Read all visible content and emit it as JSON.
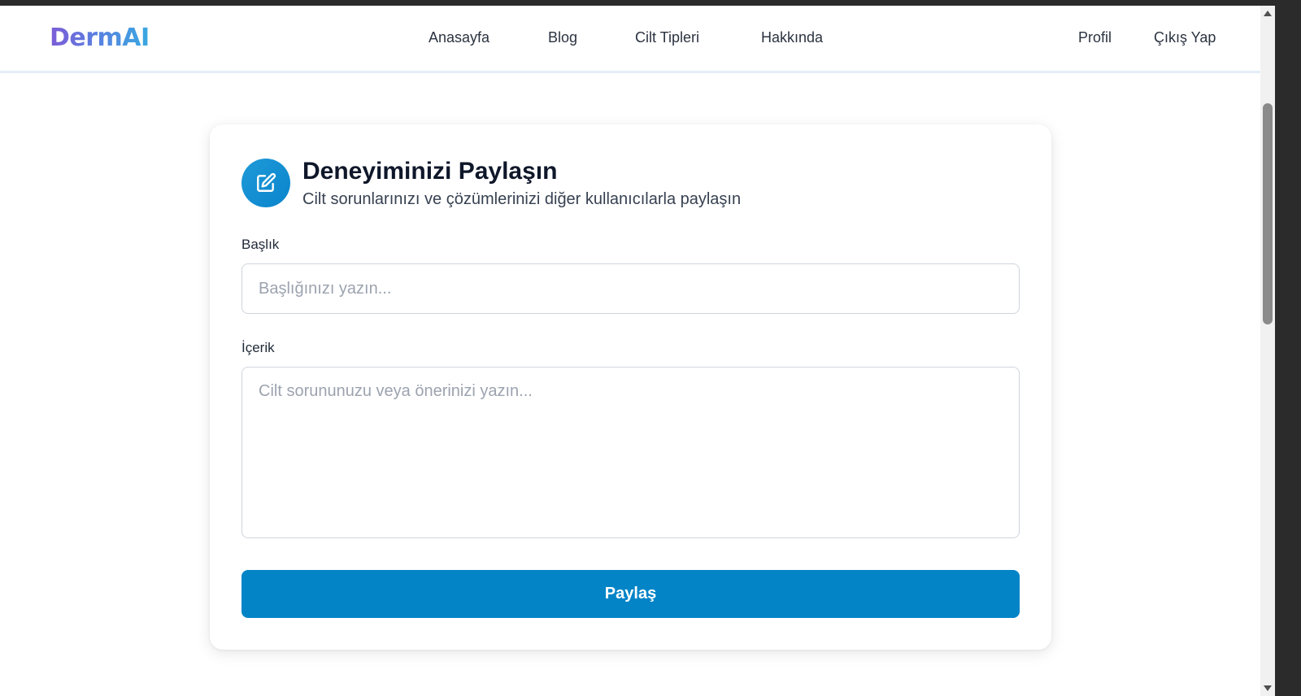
{
  "brand": {
    "logo_text": "DermAI"
  },
  "nav": {
    "links": [
      "Anasayfa",
      "Blog",
      "Cilt Tipleri",
      "Hakkında"
    ],
    "profile": "Profil",
    "logout": "Çıkış Yap"
  },
  "form": {
    "icon": "edit-icon",
    "title": "Deneyiminizi Paylaşın",
    "subtitle": "Cilt sorunlarınızı ve çözümlerinizi diğer kullanıcılarla paylaşın",
    "title_label": "Başlık",
    "title_value": "",
    "title_placeholder": "Başlığınızı yazın...",
    "content_label": "İçerik",
    "content_value": "",
    "content_placeholder": "Cilt sorununuzu veya önerinizi yazın...",
    "submit_label": "Paylaş"
  },
  "colors": {
    "accent": "#0284c7",
    "logo_gradient": [
      "#7c5cd6",
      "#38a8e0"
    ]
  }
}
